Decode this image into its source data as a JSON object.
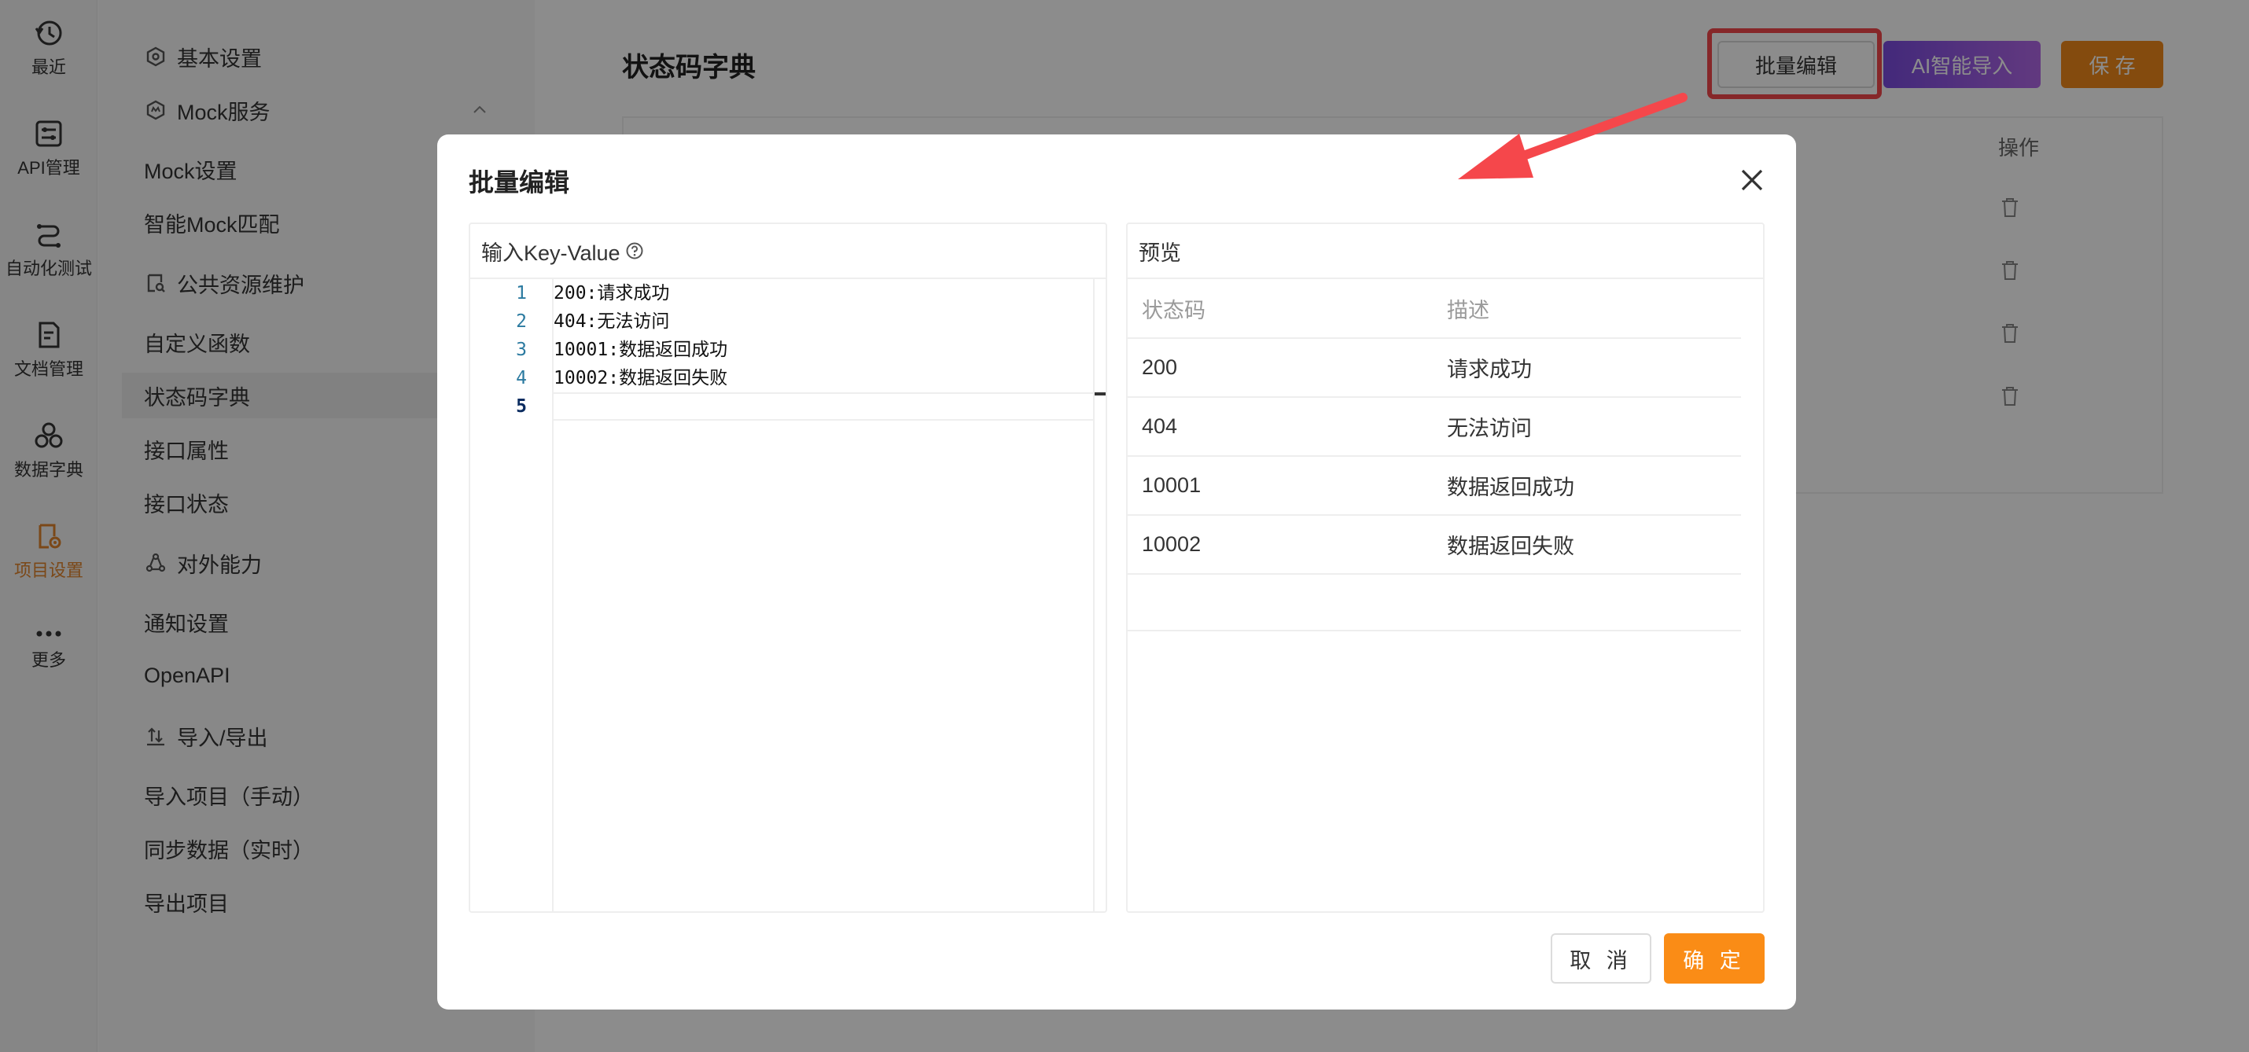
{
  "rail": {
    "items": [
      {
        "label": "最近",
        "icon": "history-icon"
      },
      {
        "label": "API管理",
        "icon": "api-icon"
      },
      {
        "label": "自动化测试",
        "icon": "automation-icon"
      },
      {
        "label": "文档管理",
        "icon": "document-icon"
      },
      {
        "label": "数据字典",
        "icon": "dictionary-icon"
      },
      {
        "label": "项目设置",
        "icon": "project-settings-icon",
        "active": true
      },
      {
        "label": "更多",
        "icon": "more-icon"
      }
    ]
  },
  "subnav": {
    "basic": "基本设置",
    "mock": "Mock服务",
    "mock_settings": "Mock设置",
    "smart_mock": "智能Mock匹配",
    "public": "公共资源维护",
    "custom_func": "自定义函数",
    "status_dict": "状态码字典",
    "api_attr": "接口属性",
    "api_status": "接口状态",
    "external": "对外能力",
    "notify": "通知设置",
    "openapi": "OpenAPI",
    "import_export": "导入/导出",
    "import_manual": "导入项目（手动）",
    "sync_realtime": "同步数据（实时）",
    "export_project": "导出项目"
  },
  "main": {
    "title": "状态码字典",
    "batch_edit": "批量编辑",
    "ai_import": "AI智能导入",
    "save": "保 存",
    "op_header": "操作"
  },
  "modal": {
    "title": "批量编辑",
    "input_header": "输入Key-Value",
    "preview_header": "预览",
    "lines": [
      {
        "no": "1",
        "text": "200:请求成功"
      },
      {
        "no": "2",
        "text": "404:无法访问"
      },
      {
        "no": "3",
        "text": "10001:数据返回成功"
      },
      {
        "no": "4",
        "text": "10002:数据返回失败"
      },
      {
        "no": "5",
        "text": ""
      }
    ],
    "preview_columns": {
      "code": "状态码",
      "desc": "描述"
    },
    "preview_rows": [
      {
        "code": "200",
        "desc": "请求成功"
      },
      {
        "code": "404",
        "desc": "无法访问"
      },
      {
        "code": "10001",
        "desc": "数据返回成功"
      },
      {
        "code": "10002",
        "desc": "数据返回失败"
      }
    ],
    "cancel": "取 消",
    "ok": "确 定"
  },
  "colors": {
    "accent": "#fa8c16",
    "highlight": "#f5474b",
    "ai_gradient_start": "#7b4ce0",
    "ai_gradient_end": "#b268e8"
  }
}
